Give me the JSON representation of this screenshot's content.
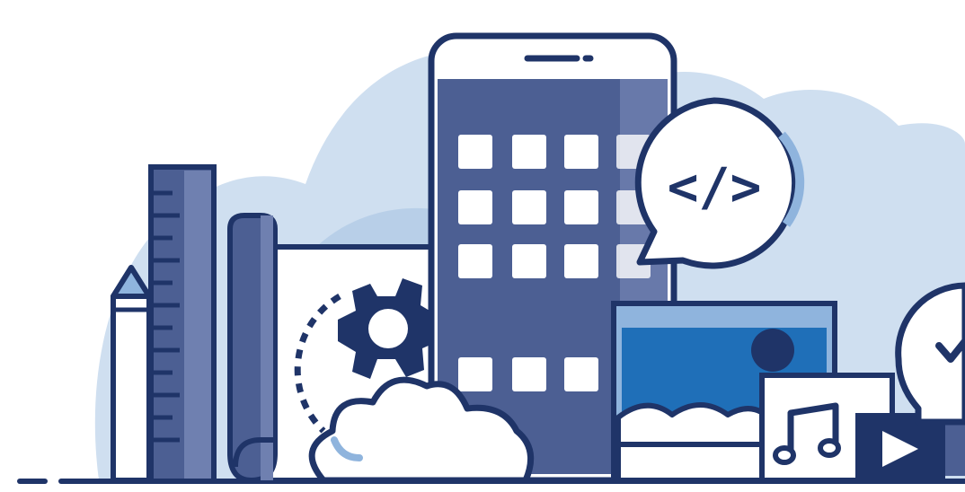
{
  "speech_bubble": {
    "code_symbol": "</>"
  },
  "colors": {
    "outline": "#1f3468",
    "navy": "#2d3f7c",
    "phone_screen": "#4c5f93",
    "cloud_bg": "#cfdff0",
    "cloud_bg_dark": "#a9c5e3",
    "light_blue": "#8fb4dd",
    "photo_blue": "#1f6fb8",
    "white": "#ffffff"
  },
  "icons": [
    "pencil-icon",
    "ruler-icon",
    "blueprint-scroll-icon",
    "gear-icon",
    "smartphone-icon",
    "code-speech-bubble-icon",
    "cloud-icon",
    "image-frame-icon",
    "music-note-icon",
    "play-button-icon",
    "lightbulb-check-icon"
  ]
}
